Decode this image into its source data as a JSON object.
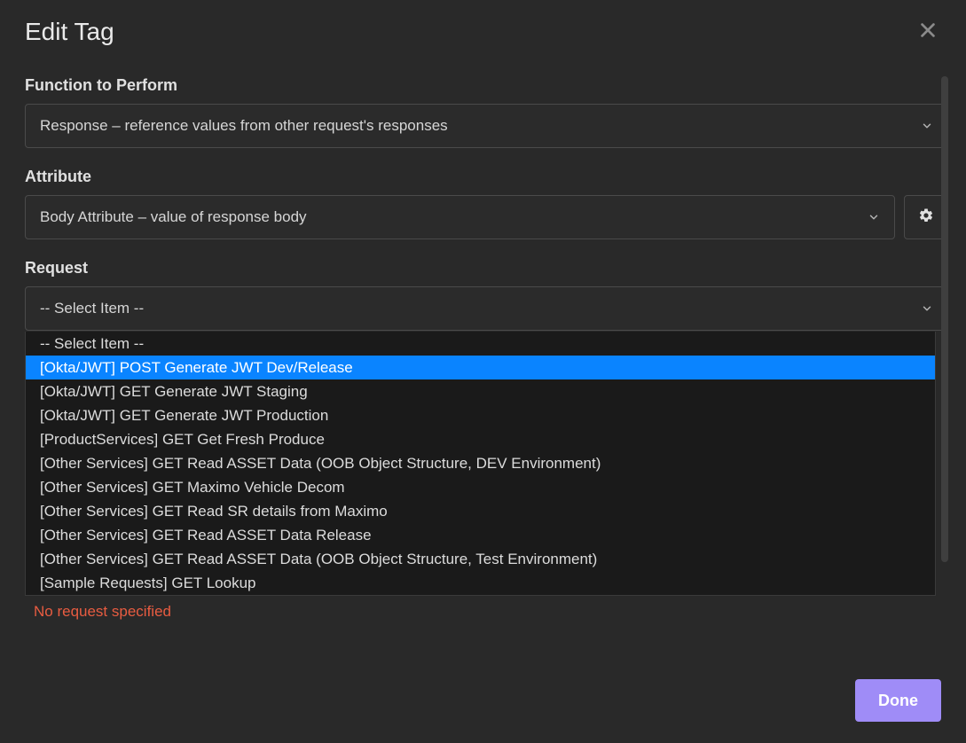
{
  "dialog": {
    "title": "Edit Tag",
    "close_icon": "close-icon"
  },
  "function": {
    "label": "Function to Perform",
    "selected": "Response – reference values from other request's responses"
  },
  "attribute": {
    "label": "Attribute",
    "selected": "Body Attribute – value of response body"
  },
  "request": {
    "label": "Request",
    "selected": "-- Select Item --",
    "options": [
      "-- Select Item --",
      "[Okta/JWT] POST Generate JWT Dev/Release",
      "[Okta/JWT] GET Generate JWT Staging",
      "[Okta/JWT] GET Generate JWT Production",
      "[ProductServices] GET Get Fresh Produce",
      "[Other Services] GET Read ASSET Data (OOB Object Structure, DEV Environment)",
      "[Other Services] GET Maximo Vehicle Decom",
      "[Other Services] GET Read SR details from Maximo",
      "[Other Services] GET Read ASSET Data Release",
      "[Other Services] GET Read ASSET Data (OOB Object Structure, Test Environment)",
      "[Sample Requests] GET Lookup"
    ],
    "highlighted_index": 1
  },
  "error": "No request specified",
  "footer": {
    "done_label": "Done"
  }
}
